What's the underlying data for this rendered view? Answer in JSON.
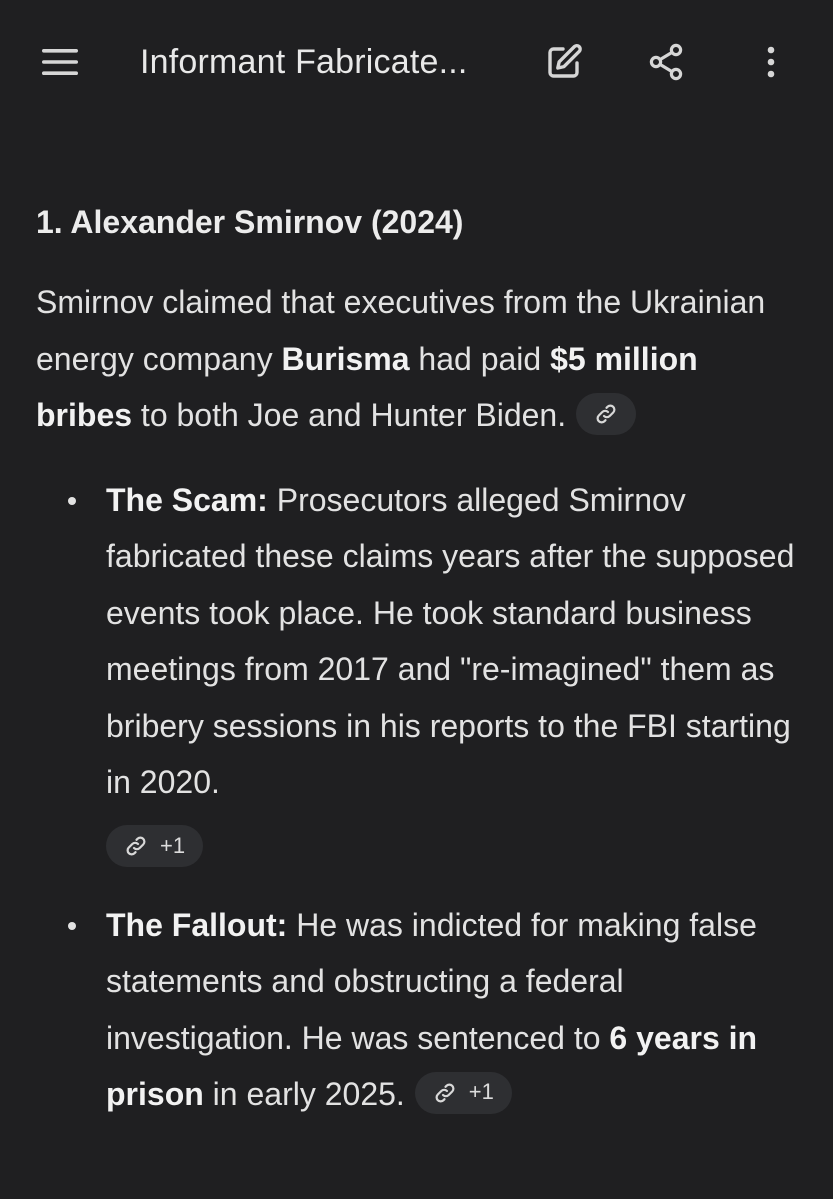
{
  "app_bar": {
    "title": "Informant Fabricate...",
    "menu_icon": "hamburger-menu-icon",
    "edit_icon": "edit-icon",
    "share_icon": "share-icon",
    "more_icon": "more-vert-icon"
  },
  "article": {
    "heading": "1. Alexander Smirnov (2024)",
    "intro": {
      "t1": "Smirnov claimed that executives from the Ukrainian energy company ",
      "b1": "Burisma",
      "t2": " had paid ",
      "b2": "$5 million bribes",
      "t3": " to both Joe and Hunter Biden."
    },
    "bullets": [
      {
        "label": "The Scam:",
        "text": " Prosecutors alleged Smirnov fabricated these claims years after the supposed events took place. He took standard business meetings from 2017 and \"re-imagined\" them as bribery sessions in his reports to the FBI starting in 2020.",
        "source_count": "+1"
      },
      {
        "label": "The Fallout:",
        "t1": " He was indicted for making false statements and obstructing a federal investigation. He was sentenced to ",
        "b1": "6 years in prison",
        "t2": " in early 2025.",
        "source_count": "+1"
      }
    ]
  },
  "colors": {
    "background": "#1f1f21",
    "text": "#e2e2e2",
    "chip_bg": "#2e2f32"
  }
}
